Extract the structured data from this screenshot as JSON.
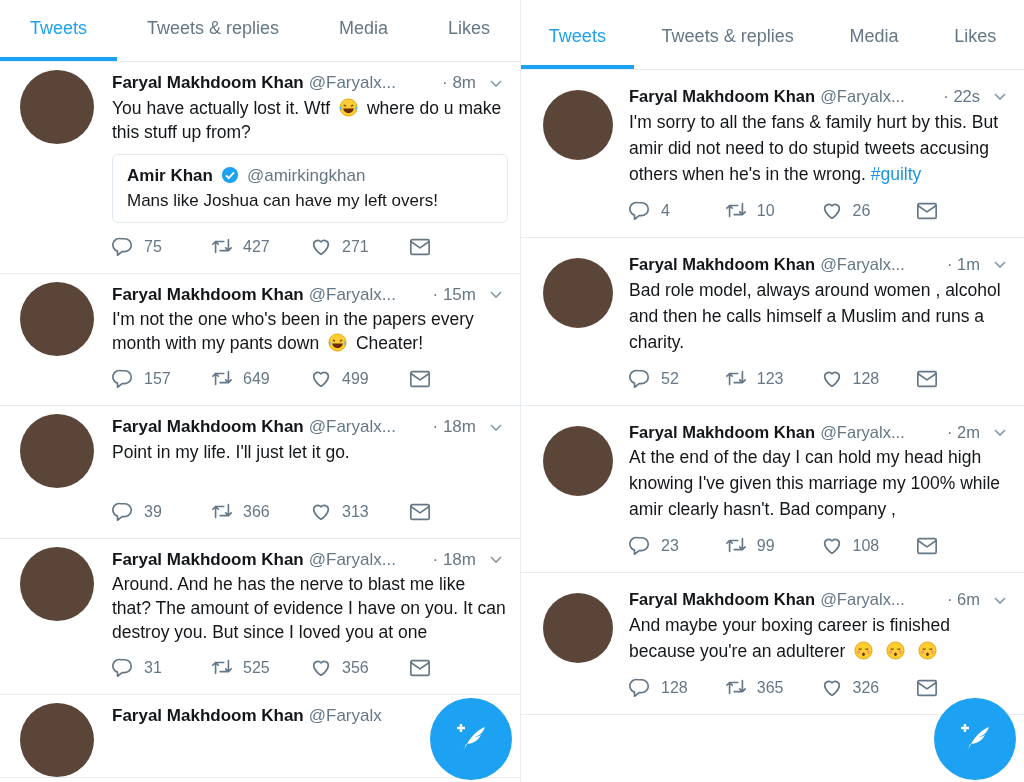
{
  "panels": [
    {
      "tabs": [
        {
          "label": "Tweets",
          "selected": true
        },
        {
          "label": "Tweets & replies",
          "selected": false
        },
        {
          "label": "Media",
          "selected": false
        },
        {
          "label": "Likes",
          "selected": false
        }
      ],
      "tweets": [
        {
          "name": "Faryal Makhdoom Khan",
          "handle": "@Faryalx...",
          "time": "· 8m",
          "text": [
            {
              "kind": "text",
              "text": "You have actually lost it. Wtf"
            },
            {
              "kind": "laughing_emoji"
            },
            {
              "kind": "text",
              "text": "where do u make this stuff up from?"
            }
          ],
          "quote": {
            "name": "Amir Khan",
            "verified": true,
            "handle": "@amirkingkhan",
            "text": "Mans like Joshua can have my left overs!"
          },
          "replies": "75",
          "retweets": "427",
          "likes": "271"
        },
        {
          "name": "Faryal Makhdoom Khan",
          "handle": "@Faryalx...",
          "time": "· 15m",
          "text": [
            {
              "kind": "text",
              "text": "I'm not the one who's been in the papers every month with my pants down"
            },
            {
              "kind": "laughing_emoji"
            },
            {
              "kind": "text",
              "text": "Cheater!"
            }
          ],
          "replies": "157",
          "retweets": "649",
          "likes": "499"
        },
        {
          "name": "Faryal Makhdoom Khan",
          "handle": "@Faryalx...",
          "time": "· 18m",
          "text": [
            {
              "kind": "text",
              "text": "Point in my life. I'll just let it go."
            }
          ],
          "replies": "39",
          "retweets": "366",
          "likes": "313"
        },
        {
          "name": "Faryal Makhdoom Khan",
          "handle": "@Faryalx...",
          "time": "· 18m",
          "text": [
            {
              "kind": "text",
              "text": "Around. And he has the nerve to blast me like that? The amount of evidence I have on you. It can destroy you. But since I loved you at one"
            }
          ],
          "replies": "31",
          "retweets": "525",
          "likes": "356"
        },
        {
          "name": "Faryal Makhdoom Khan",
          "handle": "@Faryalx"
        }
      ]
    },
    {
      "tabs": [
        {
          "label": "Tweets",
          "selected": true
        },
        {
          "label": "Tweets & replies",
          "selected": false
        },
        {
          "label": "Media",
          "selected": false
        },
        {
          "label": "Likes",
          "selected": false
        }
      ],
      "tweets": [
        {
          "name": "Faryal Makhdoom Khan",
          "handle": "@Faryalx...",
          "time": "· 22s",
          "text": [
            {
              "kind": "text",
              "text": "I'm sorry to all the fans & family hurt by this. But amir did not need to do stupid tweets accusing others when he's in the wrong."
            },
            {
              "kind": "hashtag",
              "text": "#guilty"
            }
          ],
          "replies": "4",
          "retweets": "10",
          "likes": "26"
        },
        {
          "name": "Faryal Makhdoom Khan",
          "handle": "@Faryalx...",
          "time": "· 1m",
          "text": [
            {
              "kind": "text",
              "text": "Bad role model, always around women , alcohol and then he calls himself a Muslim and runs a charity."
            }
          ],
          "replies": "52",
          "retweets": "123",
          "likes": "128"
        },
        {
          "name": "Faryal Makhdoom Khan",
          "handle": "@Faryalx...",
          "time": "· 2m",
          "text": [
            {
              "kind": "text",
              "text": "At the end of the day I can hold my head high knowing I've given this marriage my 100% while amir clearly hasn't. Bad company ,"
            }
          ],
          "replies": "23",
          "retweets": "99",
          "likes": "108"
        },
        {
          "name": "Faryal Makhdoom Khan",
          "handle": "@Faryalx...",
          "time": "· 6m",
          "text": [
            {
              "kind": "text",
              "text": "And maybe your boxing career is finished because you're an adulterer"
            },
            {
              "kind": "kissing_emoji"
            },
            {
              "kind": "kissing_emoji"
            },
            {
              "kind": "kissing_emoji"
            }
          ],
          "replies": "128",
          "retweets": "365",
          "likes": "326"
        }
      ]
    }
  ]
}
